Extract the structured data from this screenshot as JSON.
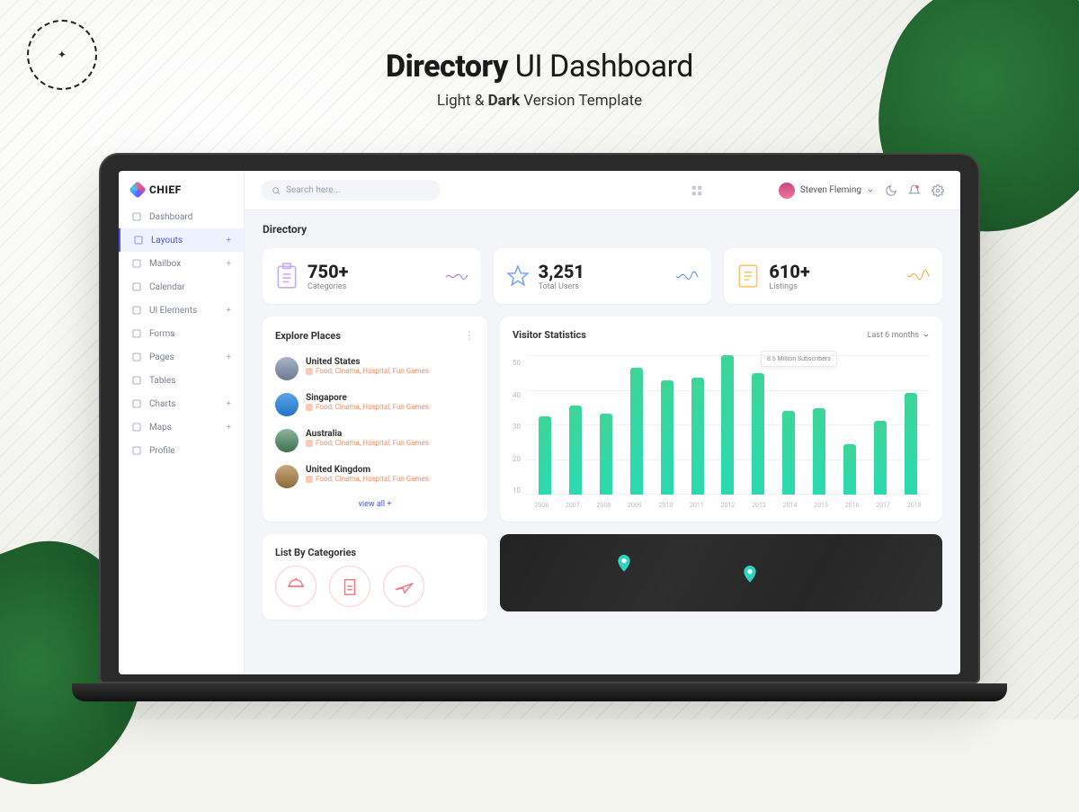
{
  "hero": {
    "title_bold": "Directory",
    "title_rest": "UI Dashboard",
    "subtitle_pre": "Light & ",
    "subtitle_bold": "Dark",
    "subtitle_post": " Version Template"
  },
  "brand": "CHIEF",
  "search_placeholder": "Search here...",
  "user_name": "Steven Fleming",
  "nav": [
    {
      "label": "Dashboard",
      "expandable": false
    },
    {
      "label": "Layouts",
      "expandable": true,
      "active": true
    },
    {
      "label": "Mailbox",
      "expandable": true
    },
    {
      "label": "Calendar",
      "expandable": false
    },
    {
      "label": "UI Elements",
      "expandable": true
    },
    {
      "label": "Forms",
      "expandable": false
    },
    {
      "label": "Pages",
      "expandable": true
    },
    {
      "label": "Tables",
      "expandable": false
    },
    {
      "label": "Charts",
      "expandable": true
    },
    {
      "label": "Maps",
      "expandable": true
    },
    {
      "label": "Profile",
      "expandable": false
    }
  ],
  "page_title": "Directory",
  "stats": [
    {
      "value": "750+",
      "label": "Categories",
      "color": "#8a5cf6"
    },
    {
      "value": "3,251",
      "label": "Total Users",
      "color": "#3b82f6"
    },
    {
      "value": "610+",
      "label": "Listings",
      "color": "#f59e0b"
    }
  ],
  "explore": {
    "title": "Explore Places",
    "items": [
      {
        "name": "United States",
        "tags": "Food, Cinema, Hospital, Fun Games"
      },
      {
        "name": "Singapore",
        "tags": "Food, Cinema, Hospital, Fun Games"
      },
      {
        "name": "Australia",
        "tags": "Food, Cinema, Hospital, Fun Games"
      },
      {
        "name": "United Kingdom",
        "tags": "Food, Cinema, Hospital, Fun Games"
      }
    ],
    "view_all": "view all +"
  },
  "chart": {
    "title": "Visitor Statistics",
    "range": "Last 6 months",
    "tooltip": "8.5 Million\nSubscribers"
  },
  "categories": {
    "title": "List By Categories"
  },
  "chart_data": {
    "type": "bar",
    "title": "Visitor Statistics",
    "xlabel": "",
    "ylabel": "",
    "ylim": [
      0,
      55
    ],
    "y_ticks": [
      50,
      40,
      30,
      20,
      10
    ],
    "categories": [
      "2006",
      "2007",
      "2008",
      "2009",
      "2010",
      "2011",
      "2012",
      "2013",
      "2014",
      "2015",
      "2016",
      "2017",
      "2018"
    ],
    "values": [
      31,
      35,
      32,
      50,
      45,
      46,
      55,
      48,
      33,
      34,
      20,
      29,
      40
    ],
    "tooltip": {
      "x": "2011",
      "label": "8.5 Million Subscribers"
    }
  }
}
